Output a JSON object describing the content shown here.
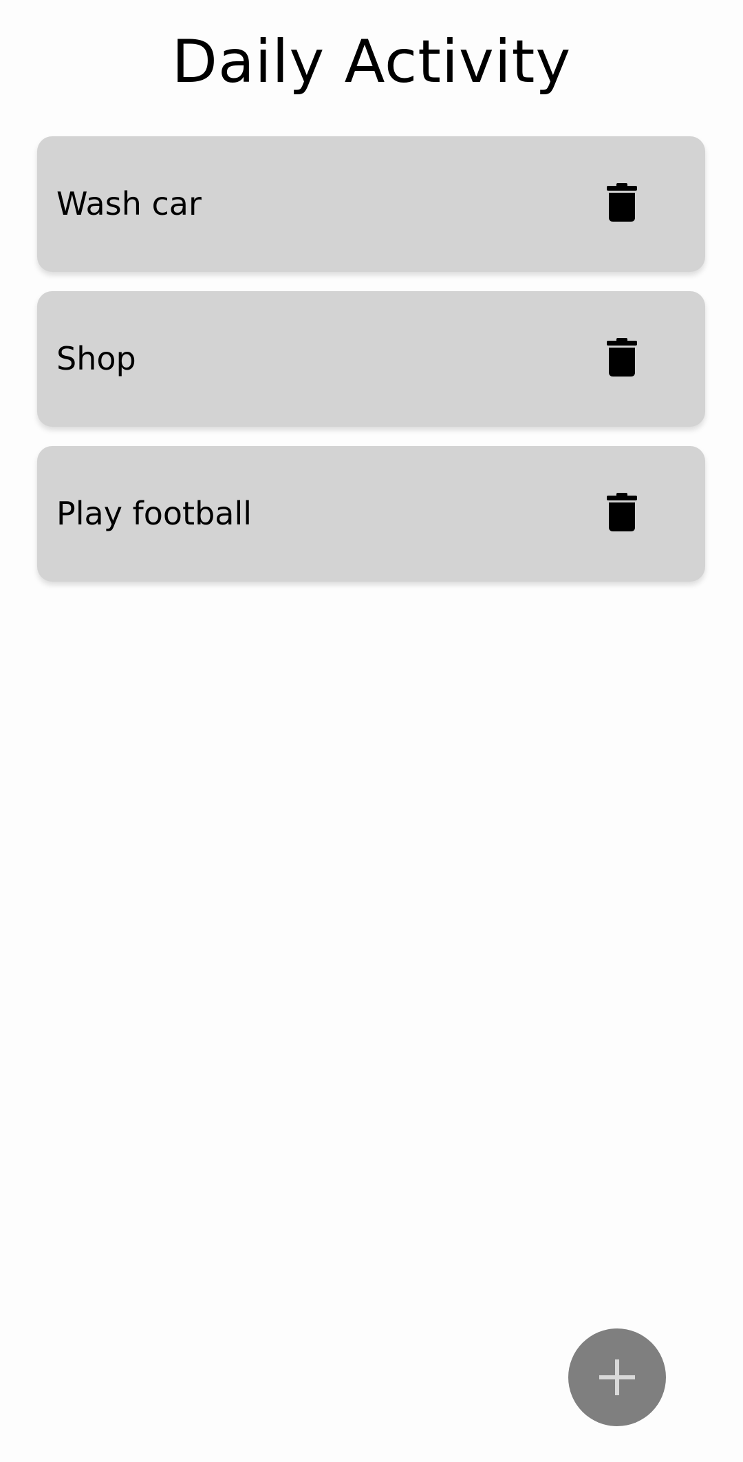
{
  "app": {
    "title": "Daily Activity"
  },
  "activities": [
    {
      "label": "Wash car",
      "action_icon": "trash-icon"
    },
    {
      "label": "Shop",
      "action_icon": "trash-icon"
    },
    {
      "label": "Play football",
      "action_icon": "trash-icon"
    }
  ],
  "fab": {
    "icon": "plus-icon"
  },
  "colors": {
    "background": "#fdfdfd",
    "card": "#d3d3d3",
    "text": "#000000",
    "fab": "#7f7f7f",
    "fab_icon": "#d9d9d9"
  }
}
